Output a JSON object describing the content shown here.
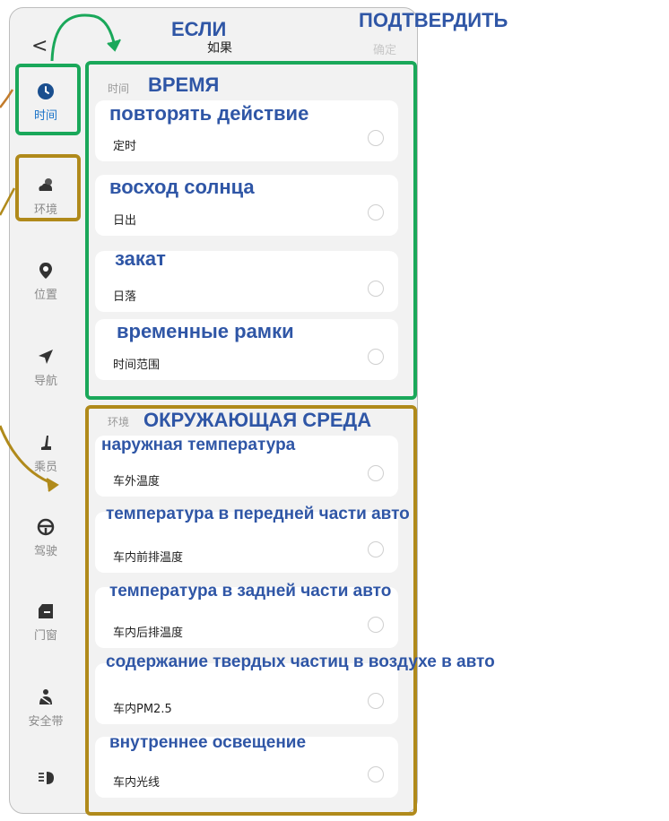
{
  "header": {
    "back": "<",
    "title": "如果",
    "confirm": "确定"
  },
  "sidebar": [
    {
      "label": "时间",
      "icon": "clock-icon",
      "active": true
    },
    {
      "label": "环境",
      "icon": "cloud-icon",
      "active": false
    },
    {
      "label": "位置",
      "icon": "location-pin-icon",
      "active": false
    },
    {
      "label": "导航",
      "icon": "navigation-arrow-icon",
      "active": false
    },
    {
      "label": "乘员",
      "icon": "seat-icon",
      "active": false
    },
    {
      "label": "驾驶",
      "icon": "steering-wheel-icon",
      "active": false
    },
    {
      "label": "门窗",
      "icon": "door-window-icon",
      "active": false
    },
    {
      "label": "安全带",
      "icon": "seatbelt-icon",
      "active": false
    },
    {
      "label": "",
      "icon": "headlight-icon",
      "active": false
    }
  ],
  "sections": [
    {
      "caption": "时间",
      "items": [
        "定时",
        "日出",
        "日落",
        "时间范围"
      ]
    },
    {
      "caption": "环境",
      "items": [
        "车外温度",
        "车内前排温度",
        "车内后排温度",
        "车内PM2.5",
        "车内光线"
      ]
    }
  ],
  "annotations": {
    "if": "ЕСЛИ",
    "confirm": "ПОДТВЕРДИТЬ",
    "time": "ВРЕМЯ",
    "repeat": "повторять действие",
    "sunrise": "восход солнца",
    "sunset": "закат",
    "timerange": "временные рамки",
    "environment": "ОКРУЖАЮЩАЯ СРЕДА",
    "outside_temp": "наружная температура",
    "front_temp": "температура в передней части авто",
    "rear_temp": "температура в задней части авто",
    "pm": "содержание твердых частиц в воздухе в авто",
    "light": "внутреннее освещение"
  },
  "colors": {
    "annotation_text": "#2f56a6",
    "green_box": "#1aa85a",
    "gold_box": "#b08a1b",
    "active_blue": "#1a73c8"
  }
}
